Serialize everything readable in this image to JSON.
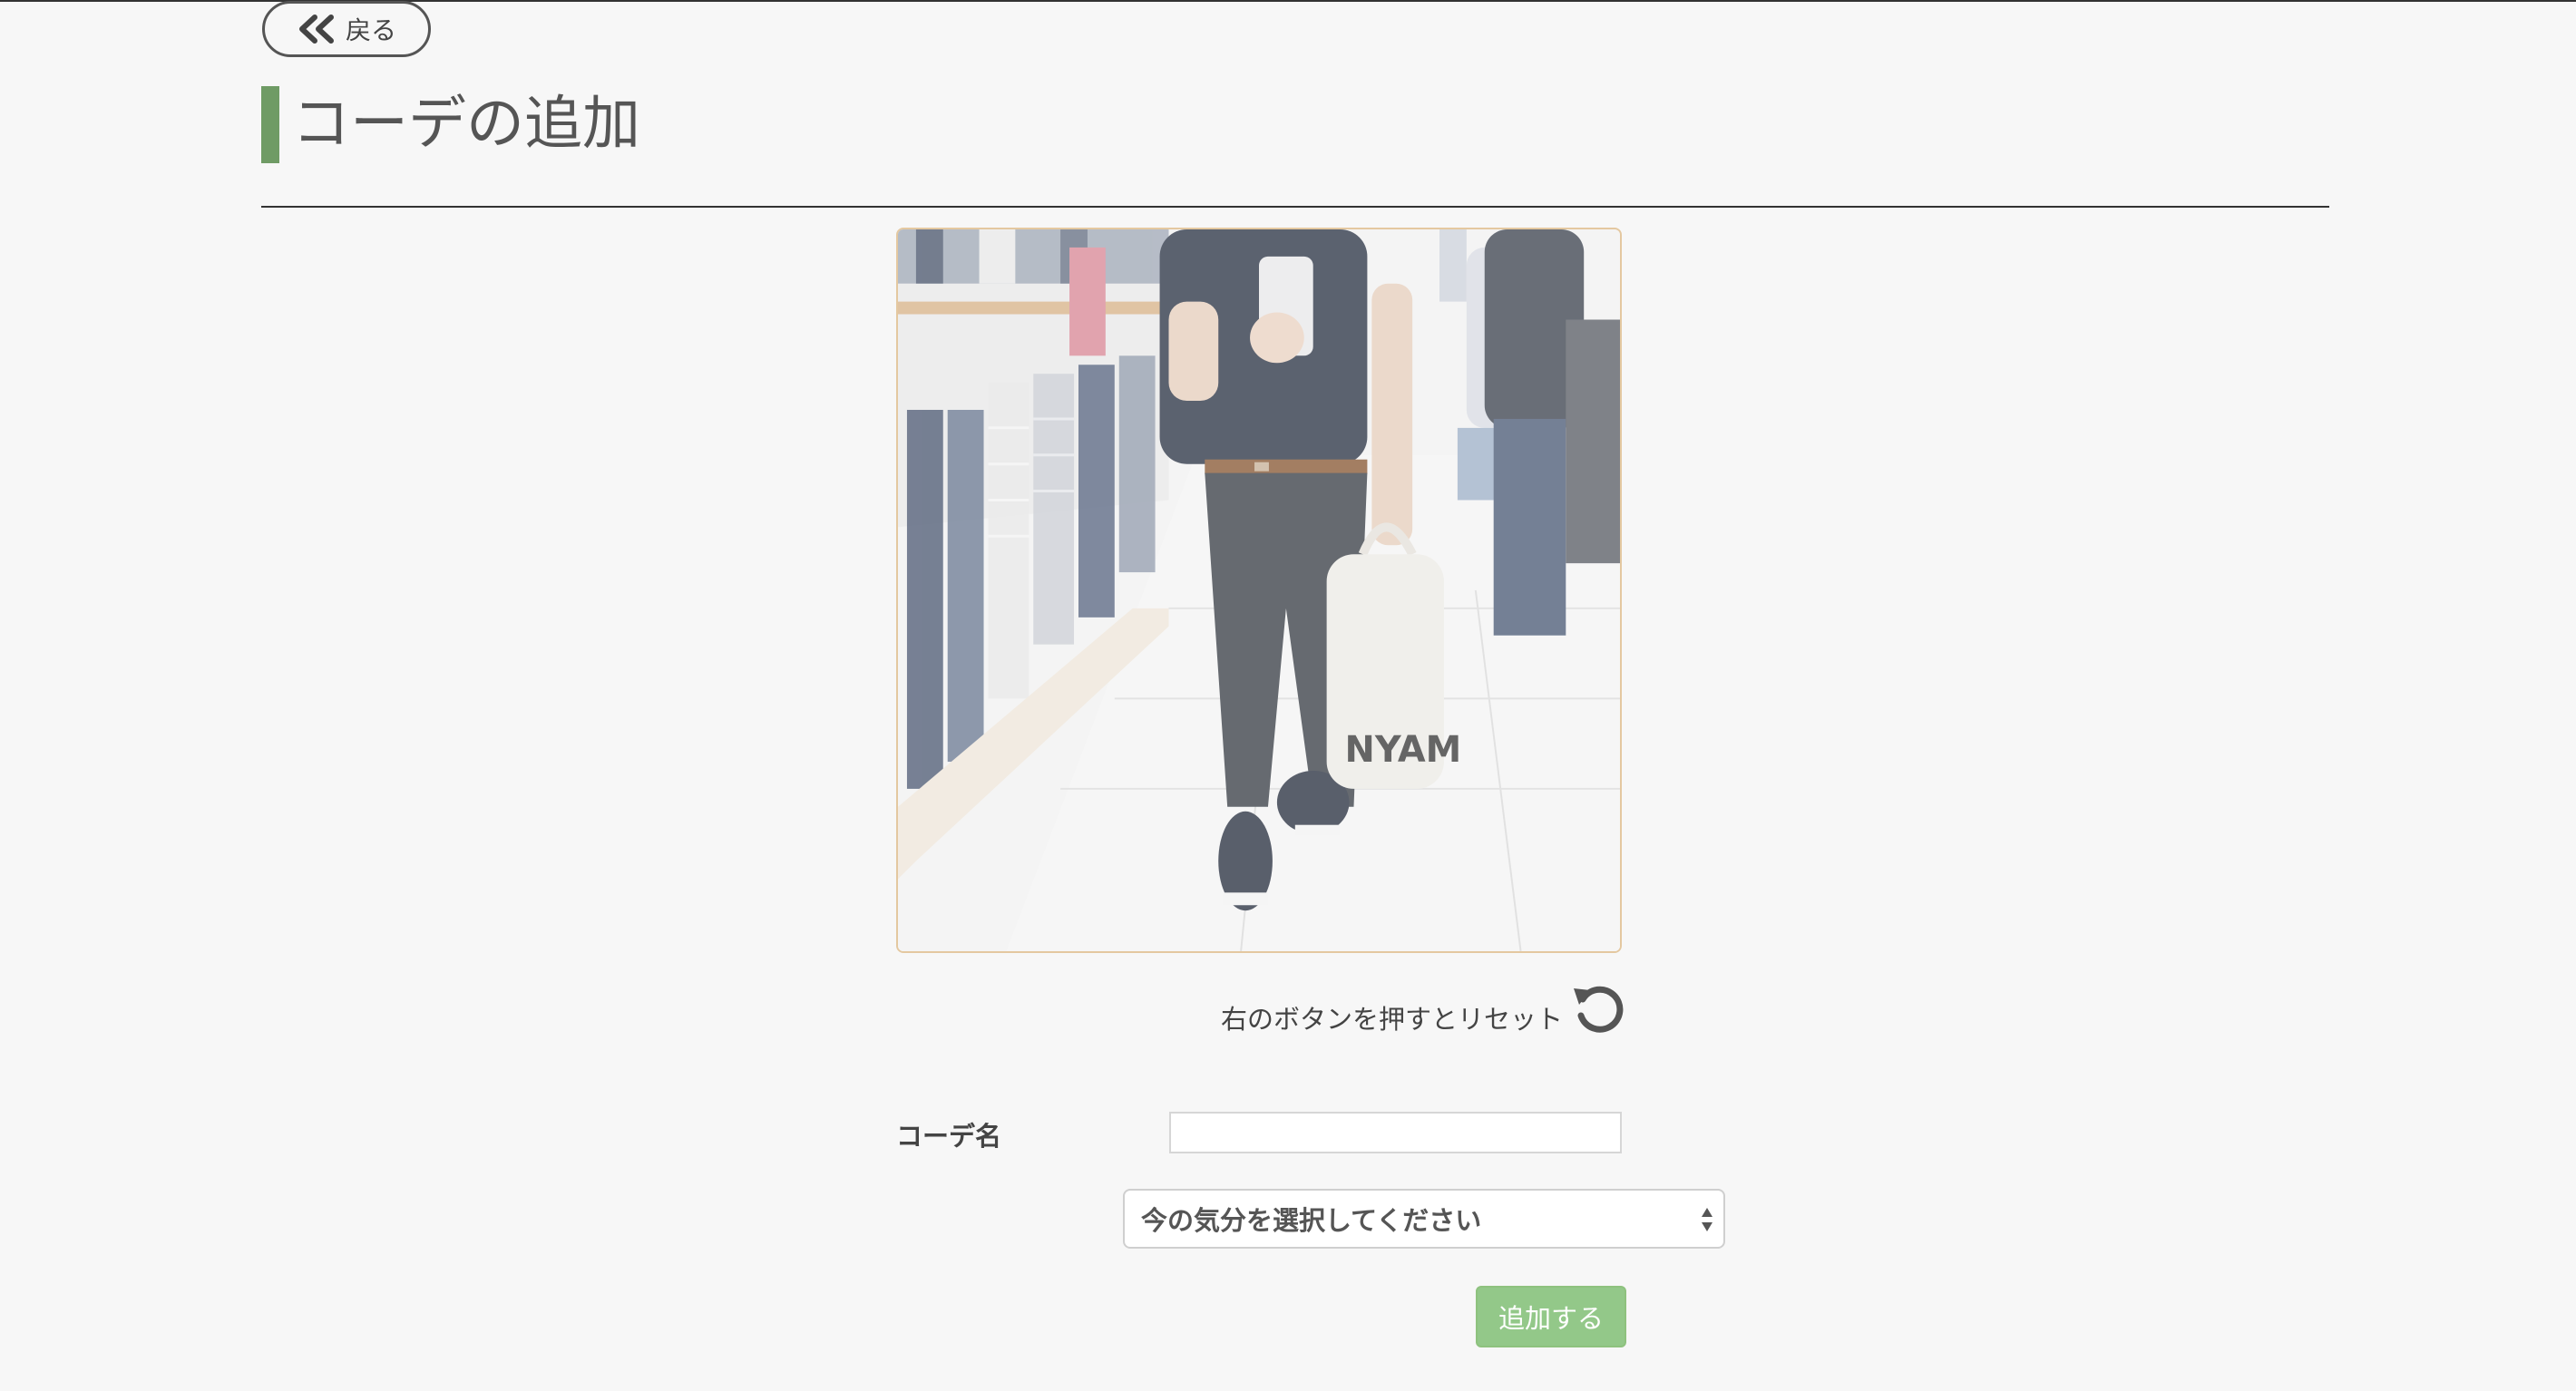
{
  "header": {
    "back_label": "戻る",
    "page_title": "コーデの追加"
  },
  "photo": {
    "alt": "コーデ写真",
    "bag_text": "NYAM"
  },
  "reset": {
    "hint": "右のボタンを押すとリセット"
  },
  "form": {
    "name_label": "コーデ名",
    "name_value": "",
    "mood_placeholder": "今の気分を選択してください",
    "submit_label": "追加する"
  },
  "colors": {
    "accent_bar": "#6f9b65",
    "submit_bg": "#93c889",
    "frame_border": "#e4c8a0"
  },
  "icons": {
    "back": "double-chevron-left-icon",
    "reset": "rotate-ccw-icon",
    "select": "up-down-arrows-icon"
  }
}
